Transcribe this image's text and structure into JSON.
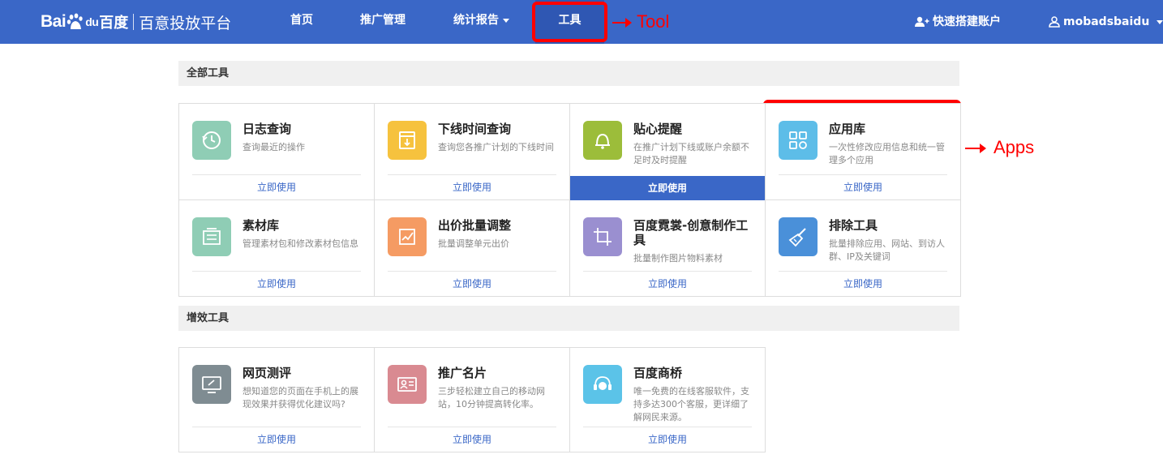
{
  "header": {
    "logo_text": "Bai",
    "logo_du": "du",
    "logo_cn": "百度",
    "platform_title": "百意投放平台",
    "nav": [
      {
        "label": "首页"
      },
      {
        "label": "推广管理"
      },
      {
        "label": "统计报告"
      },
      {
        "label": "工具"
      }
    ],
    "quick_account": "快速搭建账户",
    "username": "mobadsbaidu",
    "brand_color": "#3a67c7"
  },
  "annotations": {
    "tool_label": "Tool",
    "apps_label": "Apps",
    "color": "#ff0000"
  },
  "sections": [
    {
      "heading": "全部工具",
      "tools": [
        {
          "title": "日志查询",
          "desc": "查询最近的操作",
          "action": "立即使用",
          "icon": "clock-refresh-icon",
          "color": "#8fcdb5"
        },
        {
          "title": "下线时间查询",
          "desc": "查询您各推广计划的下线时间",
          "action": "立即使用",
          "icon": "calendar-download-icon",
          "color": "#f6c23e"
        },
        {
          "title": "贴心提醒",
          "desc": "在推广计划下线或账户余额不足时及时提醒",
          "action": "立即使用",
          "icon": "bell-icon",
          "color": "#9cbd3a"
        },
        {
          "title": "应用库",
          "desc": "一次性修改应用信息和统一管理多个应用",
          "action": "立即使用",
          "icon": "app-grid-icon",
          "color": "#5dbde8"
        },
        {
          "title": "素材库",
          "desc": "管理素材包和修改素材包信息",
          "action": "立即使用",
          "icon": "material-library-icon",
          "color": "#8fcdb5"
        },
        {
          "title": "出价批量调整",
          "desc": "批量调整单元出价",
          "action": "立即使用",
          "icon": "bid-chart-icon",
          "color": "#f59b63"
        },
        {
          "title": "百度霓裳-创意制作工具",
          "desc": "批量制作图片物料素材",
          "action": "立即使用",
          "icon": "crop-icon",
          "color": "#9a8fd0"
        },
        {
          "title": "排除工具",
          "desc": "批量排除应用、网站、到访人群、IP及关键词",
          "action": "立即使用",
          "icon": "broom-icon",
          "color": "#4a90d9"
        }
      ]
    },
    {
      "heading": "增效工具",
      "tools": [
        {
          "title": "网页测评",
          "desc": "想知道您的页面在手机上的展现效果并获得优化建议吗?",
          "action": "立即使用",
          "icon": "monitor-icon",
          "color": "#7f8c92"
        },
        {
          "title": "推广名片",
          "desc": "三步轻松建立自己的移动网站，10分钟提高转化率。",
          "action": "立即使用",
          "icon": "business-card-icon",
          "color": "#d98a91"
        },
        {
          "title": "百度商桥",
          "desc": "唯一免费的在线客服软件，支持多达300个客服，更详细了解网民来源。",
          "action": "立即使用",
          "icon": "headset-icon",
          "color": "#5bc3e8"
        }
      ]
    }
  ]
}
